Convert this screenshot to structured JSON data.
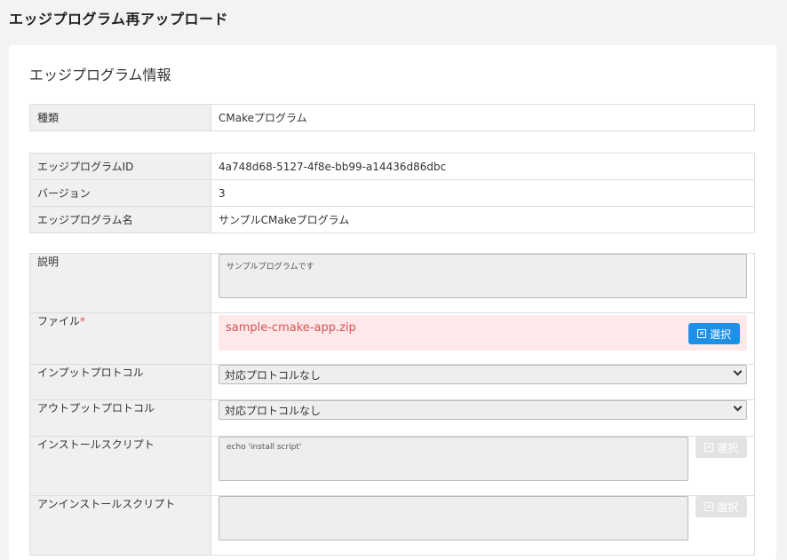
{
  "page_title": "エッジプログラム再アップロード",
  "card_title": "エッジプログラム情報",
  "type_row": {
    "label": "種類",
    "value": "CMakeプログラム"
  },
  "info_rows": [
    {
      "label": "エッジプログラムID",
      "value": "4a748d68-5127-4f8e-bb99-a14436d86dbc"
    },
    {
      "label": "バージョン",
      "value": "3"
    },
    {
      "label": "エッジプログラム名",
      "value": "サンプルCMakeプログラム"
    }
  ],
  "form": {
    "description_label": "説明",
    "description_value": "サンプルプログラムです",
    "file_label": "ファイル",
    "file_required_mark": "*",
    "file_name": "sample-cmake-app.zip",
    "select_label": "選択",
    "input_protocol_label": "インプットプロトコル",
    "input_protocol_value": "対応プロトコルなし",
    "output_protocol_label": "アウトプットプロトコル",
    "output_protocol_value": "対応プロトコルなし",
    "install_script_label": "インストールスクリプト",
    "install_script_value": "echo 'install script'",
    "uninstall_script_label": "アンインストールスクリプト",
    "uninstall_script_value": ""
  },
  "colors": {
    "accent": "#1e90e8",
    "error": "#d9534f",
    "file_bg": "#fde8ea"
  }
}
